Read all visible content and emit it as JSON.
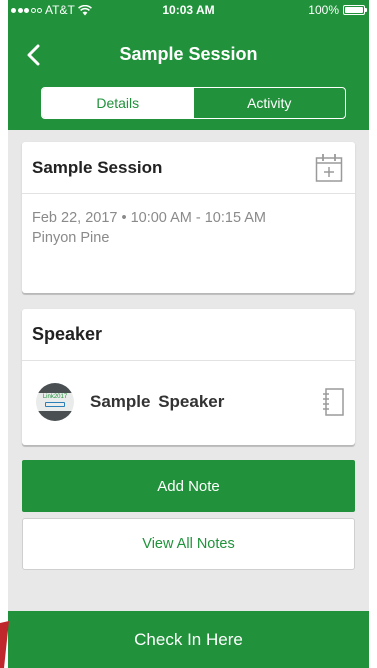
{
  "colors": {
    "brand_green": "#21923b",
    "background": "#e8e8e8",
    "muted_text": "#8a8a8a"
  },
  "status_bar": {
    "carrier": "AT&T",
    "time": "10:03 AM",
    "battery": "100%",
    "battery_level": 1.0,
    "signal_bars_filled": 3,
    "signal_bars_total": 5
  },
  "nav": {
    "title": "Sample Session",
    "back_icon": "chevron-left-icon"
  },
  "tabs": [
    {
      "label": "Details",
      "active": true
    },
    {
      "label": "Activity",
      "active": false
    }
  ],
  "session": {
    "title": "Sample Session",
    "calendar_icon": "calendar-add-icon",
    "date_time": "Feb 22, 2017 • 10:00 AM - 10:15 AM",
    "location": "Pinyon Pine"
  },
  "speaker_section": {
    "title": "Speaker",
    "speaker_name": "Sample  Speaker",
    "avatar_text": "Link2017",
    "notebook_icon": "notebook-icon"
  },
  "buttons": {
    "add_note": "Add Note",
    "view_all_notes": "View All Notes",
    "check_in": "Check In Here"
  }
}
